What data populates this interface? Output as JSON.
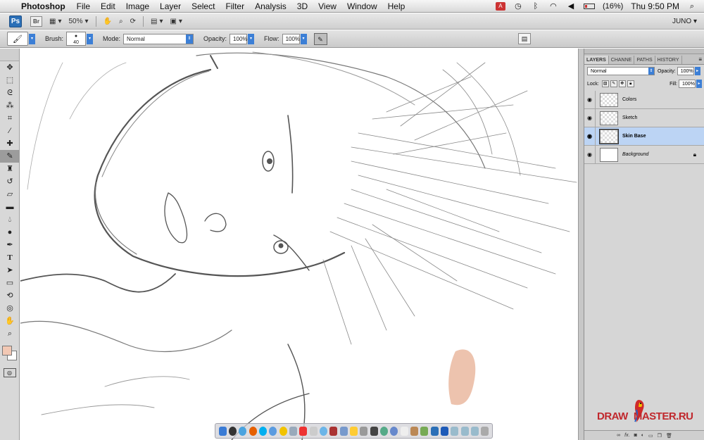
{
  "menubar": {
    "app_name": "Photoshop",
    "items": [
      "File",
      "Edit",
      "Image",
      "Layer",
      "Select",
      "Filter",
      "Analysis",
      "3D",
      "View",
      "Window",
      "Help"
    ],
    "battery": "(16%)",
    "clock": "Thu 9:50 PM",
    "icons": [
      "apple-icon",
      "adobe-icon",
      "time-machine-icon",
      "bluetooth-icon",
      "wifi-icon",
      "volume-icon",
      "battery-icon",
      "spotlight-icon"
    ]
  },
  "appbar": {
    "ps_label": "Ps",
    "br_label": "Br",
    "zoom": "50%",
    "workspace": "JUNO"
  },
  "options": {
    "brush_label": "Brush:",
    "brush_size": "40",
    "mode_label": "Mode:",
    "mode_value": "Normal",
    "opacity_label": "Opacity:",
    "opacity_value": "100%",
    "flow_label": "Flow:",
    "flow_value": "100%"
  },
  "tools": [
    "move-tool",
    "marquee-tool",
    "lasso-tool",
    "quick-selection-tool",
    "crop-tool",
    "eyedropper-tool",
    "spot-healing-tool",
    "brush-tool",
    "clone-stamp-tool",
    "history-brush-tool",
    "eraser-tool",
    "gradient-tool",
    "blur-tool",
    "dodge-tool",
    "pen-tool",
    "type-tool",
    "path-selection-tool",
    "rectangle-tool",
    "3d-rotate-tool",
    "3d-orbit-tool",
    "hand-tool",
    "zoom-tool"
  ],
  "colors": {
    "foreground": "#f2c8b4",
    "background": "#ffffff",
    "skin_stroke": "#eab8a0",
    "selected_layer": "#bcd4f4"
  },
  "layers_panel": {
    "tabs": [
      "LAYERS",
      "CHANNE",
      "PATHS",
      "HISTORY"
    ],
    "blend_mode": "Normal",
    "opacity_label": "Opacity:",
    "opacity_value": "100%",
    "lock_label": "Lock:",
    "fill_label": "Fill:",
    "fill_value": "100%",
    "layers": [
      {
        "name": "Colors",
        "selected": false,
        "italic": false
      },
      {
        "name": "Sketch",
        "selected": false,
        "italic": false
      },
      {
        "name": "Skin Base",
        "selected": true,
        "italic": false
      },
      {
        "name": "Background",
        "selected": false,
        "italic": true,
        "locked": true
      }
    ],
    "footer_icons": [
      "link-icon",
      "fx-icon",
      "mask-icon",
      "adjustment-icon",
      "group-icon",
      "new-layer-icon",
      "trash-icon"
    ]
  },
  "watermark": {
    "text_a": "DRAW",
    "text_b": "MASTER.RU"
  }
}
